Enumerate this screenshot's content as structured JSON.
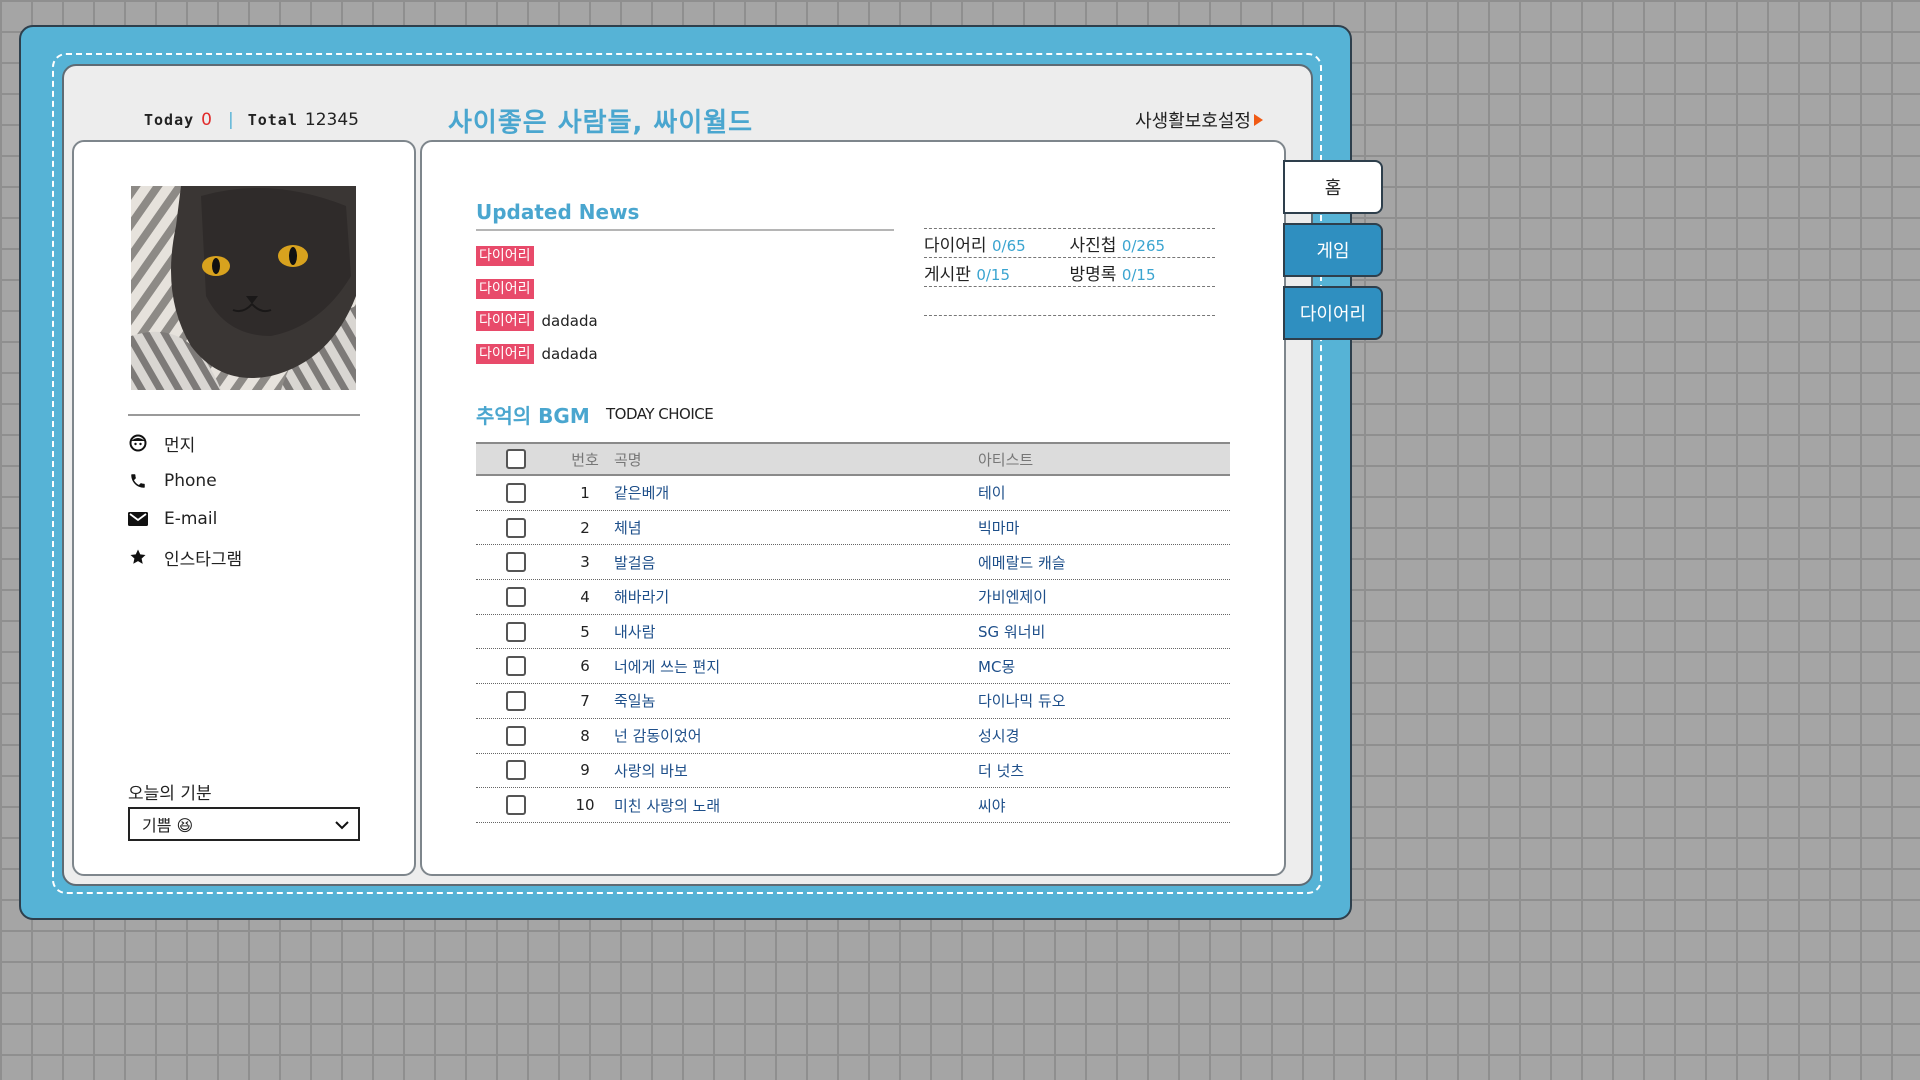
{
  "header": {
    "today_label": "Today",
    "today_count": "0",
    "separator": "|",
    "total_label": "Total",
    "total_count": "12345",
    "site_title": "사이좋은 사람들, 싸이월드",
    "privacy_label": "사생활보호설정"
  },
  "profile": {
    "photo": "cat-photo",
    "items": [
      {
        "icon": "smiley-face-icon",
        "label": "먼지"
      },
      {
        "icon": "phone-icon",
        "label": "Phone"
      },
      {
        "icon": "email-icon",
        "label": "E-mail"
      },
      {
        "icon": "star-icon",
        "label": "인스타그램"
      }
    ],
    "mood_label": "오늘의 기분",
    "mood_value": "기쁨 😆"
  },
  "news": {
    "title": "Updated News",
    "items": [
      {
        "badge": "다이어리",
        "text": ""
      },
      {
        "badge": "다이어리",
        "text": ""
      },
      {
        "badge": "다이어리",
        "text": "dadada"
      },
      {
        "badge": "다이어리",
        "text": "dadada"
      }
    ]
  },
  "stats": {
    "diary_label": "다이어리",
    "diary_value": "0/65",
    "album_label": "사진첩",
    "album_value": "0/265",
    "board_label": "게시판",
    "board_value": "0/15",
    "guestbook_label": "방명록",
    "guestbook_value": "0/15"
  },
  "bgm": {
    "title": "추억의 BGM",
    "subtitle": "TODAY CHOICE",
    "headers": {
      "number": "번호",
      "song": "곡명",
      "artist": "아티스트"
    },
    "rows": [
      {
        "number": "1",
        "song": "같은베개",
        "artist": "테이"
      },
      {
        "number": "2",
        "song": "체념",
        "artist": "빅마마"
      },
      {
        "number": "3",
        "song": "발걸음",
        "artist": "에메랄드 캐슬"
      },
      {
        "number": "4",
        "song": "해바라기",
        "artist": "가비엔제이"
      },
      {
        "number": "5",
        "song": "내사람",
        "artist": "SG 워너비"
      },
      {
        "number": "6",
        "song": "너에게 쓰는 편지",
        "artist": "MC몽"
      },
      {
        "number": "7",
        "song": "죽일놈",
        "artist": "다이나믹 듀오"
      },
      {
        "number": "8",
        "song": "넌 감동이었어",
        "artist": "성시경"
      },
      {
        "number": "9",
        "song": "사랑의 바보",
        "artist": "더 넛츠"
      },
      {
        "number": "10",
        "song": "미친 사랑의 노래",
        "artist": "씨야"
      }
    ]
  },
  "tabs": [
    {
      "label": "홈",
      "active": true
    },
    {
      "label": "게임",
      "active": false
    },
    {
      "label": "다이어리",
      "active": false
    }
  ],
  "colors": {
    "frame_blue": "#56b3d6",
    "accent_blue": "#4aa6cf",
    "tab_blue": "#2f8fc0",
    "badge_pink": "#e84a6a",
    "today_red": "#e12b2b",
    "arrow_orange": "#f05a14",
    "song_text": "#1e4f8a"
  }
}
